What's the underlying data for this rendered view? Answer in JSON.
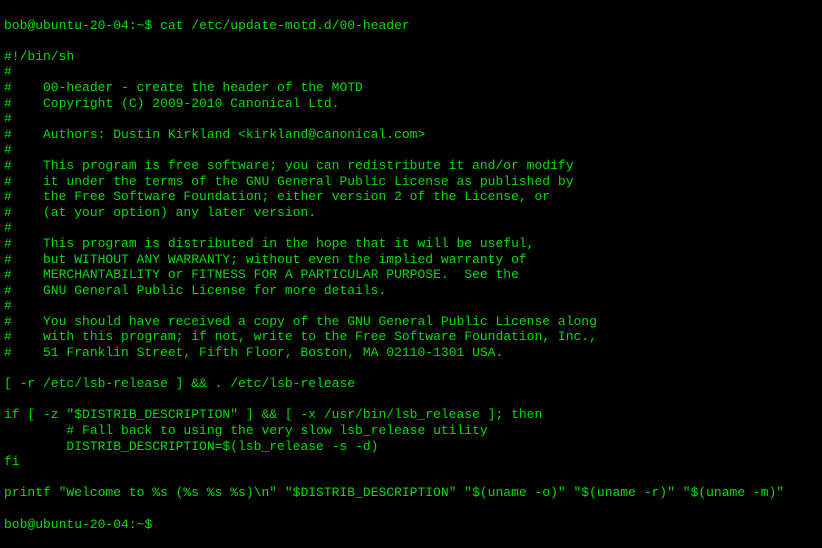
{
  "prompt1": {
    "user_host": "bob@ubuntu-20-04",
    "sep": ":",
    "path": "~",
    "dollar": "$",
    "command": " cat /etc/update-motd.d/00-header"
  },
  "output_lines": [
    "#!/bin/sh",
    "#",
    "#    00-header - create the header of the MOTD",
    "#    Copyright (C) 2009-2010 Canonical Ltd.",
    "#",
    "#    Authors: Dustin Kirkland <kirkland@canonical.com>",
    "#",
    "#    This program is free software; you can redistribute it and/or modify",
    "#    it under the terms of the GNU General Public License as published by",
    "#    the Free Software Foundation; either version 2 of the License, or",
    "#    (at your option) any later version.",
    "#",
    "#    This program is distributed in the hope that it will be useful,",
    "#    but WITHOUT ANY WARRANTY; without even the implied warranty of",
    "#    MERCHANTABILITY or FITNESS FOR A PARTICULAR PURPOSE.  See the",
    "#    GNU General Public License for more details.",
    "#",
    "#    You should have received a copy of the GNU General Public License along",
    "#    with this program; if not, write to the Free Software Foundation, Inc.,",
    "#    51 Franklin Street, Fifth Floor, Boston, MA 02110-1301 USA.",
    "",
    "[ -r /etc/lsb-release ] && . /etc/lsb-release",
    "",
    "if [ -z \"$DISTRIB_DESCRIPTION\" ] && [ -x /usr/bin/lsb_release ]; then",
    "        # Fall back to using the very slow lsb_release utility",
    "        DISTRIB_DESCRIPTION=$(lsb_release -s -d)",
    "fi",
    "",
    "printf \"Welcome to %s (%s %s %s)\\n\" \"$DISTRIB_DESCRIPTION\" \"$(uname -o)\" \"$(uname -r)\" \"$(uname -m)\""
  ],
  "prompt2": {
    "user_host": "bob@ubuntu-20-04",
    "sep": ":",
    "path": "~",
    "dollar": "$",
    "command": " "
  }
}
